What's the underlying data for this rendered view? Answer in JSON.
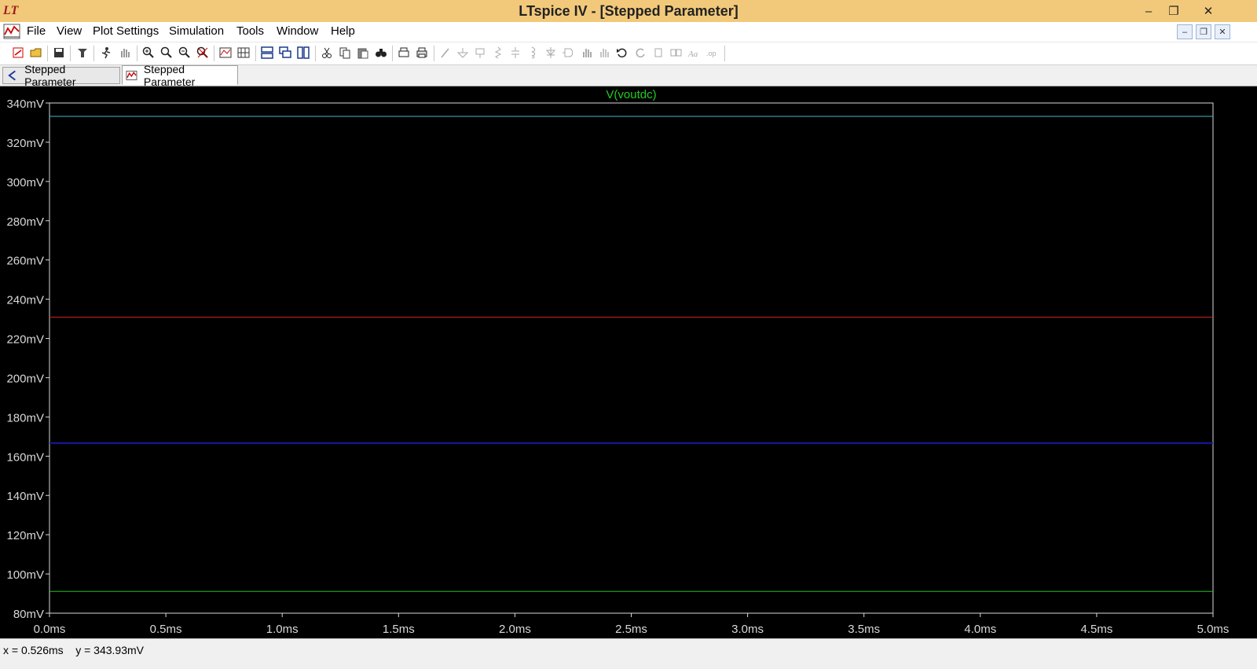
{
  "window": {
    "title": "LTspice IV - [Stepped Parameter]",
    "logo_text": "LT",
    "controls": {
      "minimize": "–",
      "restore": "❐",
      "close": "✕"
    }
  },
  "menu": {
    "items": [
      "File",
      "View",
      "Plot Settings",
      "Simulation",
      "Tools",
      "Window",
      "Help"
    ],
    "mdi_controls": {
      "minimize": "–",
      "restore": "❐",
      "close": "✕"
    }
  },
  "toolbar": {
    "icons": [
      "new-schematic-icon",
      "open-folder-icon",
      "save-icon",
      "control-panel-icon",
      "run-icon",
      "halt-icon",
      "zoom-in-icon",
      "zoom-area-icon",
      "zoom-out-icon",
      "zoom-fit-icon",
      "autorange-icon",
      "grid-icon",
      "tile-horizontal-icon",
      "cascade-icon",
      "tile-vertical-icon",
      "cut-icon",
      "copy-icon",
      "paste-icon",
      "find-icon",
      "print-preview-icon",
      "print-icon",
      "wire-icon",
      "ground-icon",
      "label-icon",
      "resistor-icon",
      "capacitor-icon",
      "inductor-icon",
      "diode-icon",
      "component-icon",
      "move-icon",
      "drag-icon",
      "undo-icon",
      "redo-icon",
      "rotate-icon",
      "mirror-icon",
      "text-icon",
      "spice-directive-icon"
    ]
  },
  "tabs": [
    {
      "label": "Stepped Parameter",
      "icon": "schematic-icon",
      "active": false
    },
    {
      "label": "Stepped Parameter",
      "icon": "waveform-icon",
      "active": true
    }
  ],
  "status": {
    "text": "x = 0.526ms    y = 343.93mV"
  },
  "colors": {
    "plot_bg": "#000000",
    "axis": "#d8d8d8",
    "title": "#22cc22"
  },
  "chart_data": {
    "type": "line",
    "title": "V(voutdc)",
    "xlabel": "",
    "ylabel": "",
    "xlim": [
      0,
      5.0
    ],
    "ylim": [
      80,
      340
    ],
    "x_ticks": [
      "0.0ms",
      "0.5ms",
      "1.0ms",
      "1.5ms",
      "2.0ms",
      "2.5ms",
      "3.0ms",
      "3.5ms",
      "4.0ms",
      "4.5ms",
      "5.0ms"
    ],
    "y_ticks": [
      "340mV",
      "320mV",
      "300mV",
      "280mV",
      "260mV",
      "240mV",
      "220mV",
      "200mV",
      "180mV",
      "160mV",
      "140mV",
      "120mV",
      "100mV",
      "80mV"
    ],
    "grid": false,
    "series": [
      {
        "color": "#3fb7c4",
        "x": [
          0,
          5.0
        ],
        "y": [
          333.2,
          333.2
        ]
      },
      {
        "color": "#d42020",
        "x": [
          0,
          5.0
        ],
        "y": [
          230.9,
          230.9
        ]
      },
      {
        "color": "#1a1aaa",
        "x": [
          0,
          5.0
        ],
        "y": [
          166.7,
          166.7
        ]
      },
      {
        "color": "#1fbf1f",
        "x": [
          0,
          5.0
        ],
        "y": [
          91.1,
          91.1
        ]
      }
    ]
  }
}
